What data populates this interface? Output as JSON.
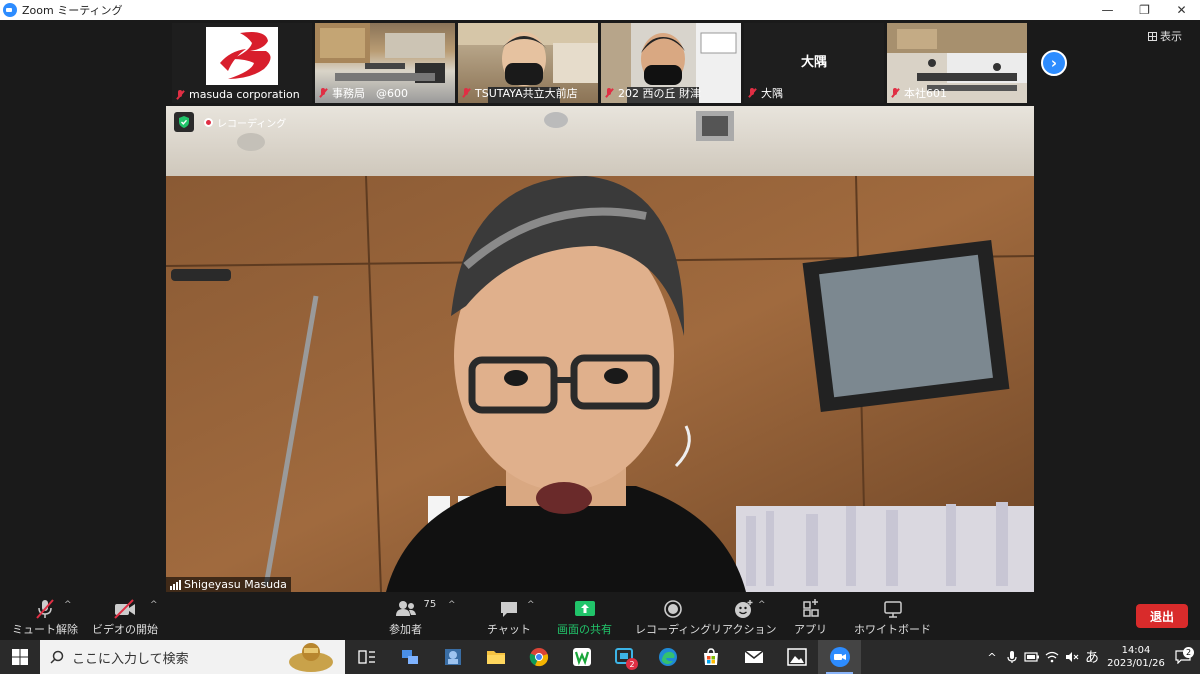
{
  "window": {
    "title": "Zoom ミーティング",
    "controls": {
      "minimize": "—",
      "restore": "❐",
      "close": "✕"
    }
  },
  "gallery": {
    "participants": [
      {
        "name": "masuda corporation",
        "muted": true
      },
      {
        "name": "事務局　@600",
        "muted": true
      },
      {
        "name": "TSUTAYA共立大前店",
        "muted": true
      },
      {
        "name": "202 西の丘 財津",
        "muted": true
      },
      {
        "name": "大隅",
        "muted": true,
        "center_name": "大隅"
      },
      {
        "name": "本社601",
        "muted": true
      }
    ],
    "view_label": "表示"
  },
  "main_video": {
    "recording_label": "レコーディング",
    "speaker_name": "Shigeyasu Masuda"
  },
  "toolbar": {
    "mute_label": "ミュート解除",
    "video_label": "ビデオの開始",
    "participants_label": "参加者",
    "participants_count": "75",
    "chat_label": "チャット",
    "share_label": "画面の共有",
    "record_label": "レコーディング",
    "reaction_label": "リアクション",
    "apps_label": "アプリ",
    "whiteboard_label": "ホワイトボード",
    "leave_label": "退出"
  },
  "taskbar": {
    "search_placeholder": "ここに入力して検索",
    "ime_label": "あ",
    "time": "14:04",
    "date": "2023/01/26",
    "notification_count": "2",
    "badge_count": "2"
  },
  "colors": {
    "zoom_blue": "#2d8cff",
    "leave_red": "#d92b2b",
    "share_green": "#21c46a",
    "muted_red": "#e02f44"
  }
}
